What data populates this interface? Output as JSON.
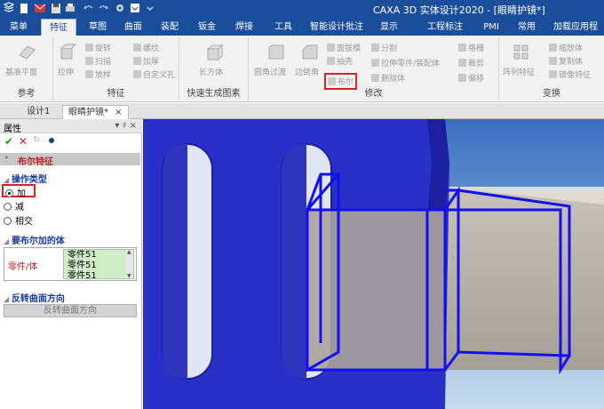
{
  "window": {
    "title": "CAXA 3D 实体设计2020 - [眼睛护镜*]"
  },
  "menu_tabs": [
    "菜单",
    "特征",
    "草图",
    "曲面",
    "装配",
    "钣金",
    "焊接",
    "工具",
    "智能设计批注",
    "显示",
    "工程标注",
    "PMI",
    "常用",
    "加载应用程"
  ],
  "active_menu_tab": "特征",
  "ribbon": {
    "groups": {
      "reference": "参考",
      "features": "特征",
      "quick": "快速生成图素",
      "modify": "修改",
      "transform": "变换"
    },
    "buttons": {
      "datum_plane": "基准平面",
      "extrude": "拉伸",
      "revolve": "旋转",
      "sweep": "扫描",
      "loft": "放样",
      "thread": "螺纹",
      "thicken": "加厚",
      "custom_hole": "自定义孔",
      "box": "长方体",
      "fillet": "圆角过渡",
      "chamfer": "边倒角",
      "draft": "面拔模",
      "shell": "抽壳",
      "boolean": "布尔",
      "split": "分割",
      "extrude_to": "拉伸零件/装配体",
      "delete_body": "删除体",
      "mesh": "格栅",
      "cut": "裁剪",
      "offset": "偏移",
      "pattern": "阵列特征",
      "scale": "缩放体",
      "copy": "复制体",
      "mirror": "镜像特征"
    }
  },
  "doc_tabs": [
    "设计1",
    "眼睛护镜*"
  ],
  "active_doc_tab": "眼睛护镜*",
  "panel": {
    "title": "属性",
    "pin_close": "▾ ♯ ×",
    "feature_name": "布尔特征",
    "op_type_label": "操作类型",
    "options": [
      "加",
      "减",
      "相交"
    ],
    "selected_option": "加",
    "bodies_label": "要布尔加的体",
    "parts_label": "零件/体",
    "parts_list": [
      "零件51",
      "零件51",
      "零件51"
    ],
    "reverse_label": "反转曲面方向",
    "reverse_button": "反转曲面方向"
  },
  "colors": {
    "titlebar": "#1a4e9a",
    "highlight": "#e02020",
    "part_blue": "#2a2fc8",
    "selection": "#1010f0"
  }
}
